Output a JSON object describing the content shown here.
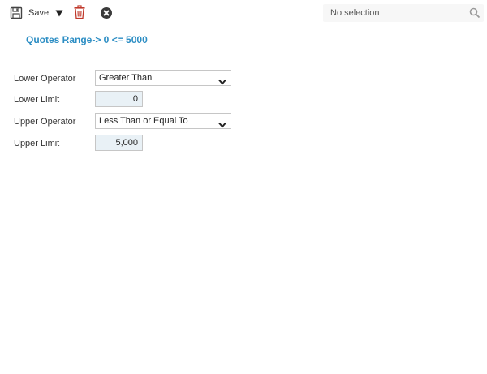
{
  "toolbar": {
    "save_label": "Save",
    "icons": {
      "save": "floppy-disk-icon",
      "dropdown": "caret-down-icon",
      "delete": "trash-icon",
      "close": "circle-x-icon",
      "search": "magnifier-icon"
    }
  },
  "search": {
    "value": "No selection",
    "placeholder": "No selection"
  },
  "title": "Quotes Range-> 0 <= 5000",
  "form": {
    "lower_operator": {
      "label": "Lower Operator",
      "value": "Greater Than"
    },
    "lower_limit": {
      "label": "Lower Limit",
      "value": "0"
    },
    "upper_operator": {
      "label": "Upper Operator",
      "value": "Less Than or Equal To"
    },
    "upper_limit": {
      "label": "Upper Limit",
      "value": "5,000"
    }
  },
  "colors": {
    "title": "#2d8ec4",
    "delete_icon": "#c0392b",
    "input_bg": "#e9f1f6"
  }
}
